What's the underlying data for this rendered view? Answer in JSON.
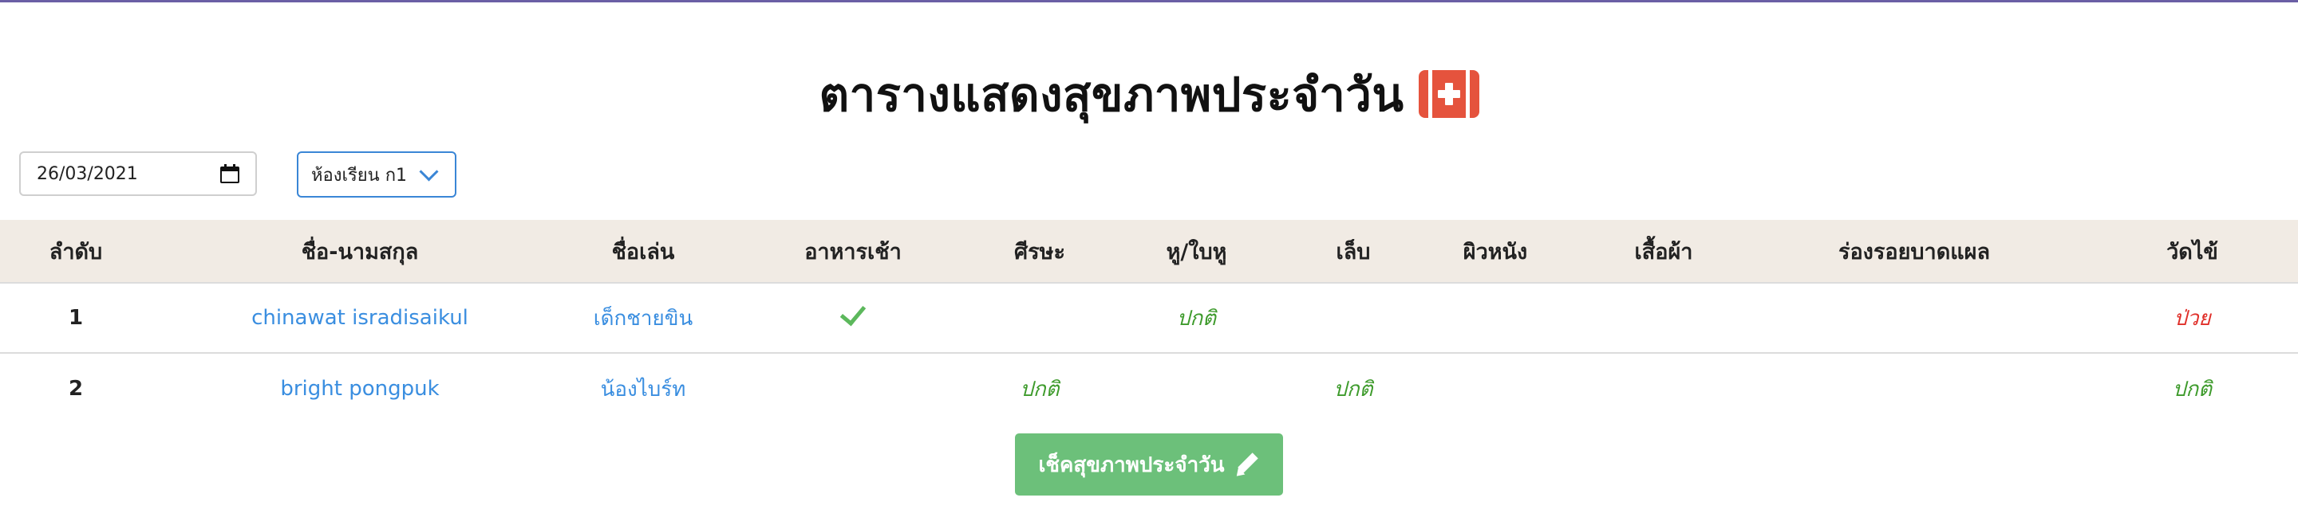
{
  "header": {
    "title": "ตารางแสดงสุขภาพประจำวัน",
    "title_icon": "medical-kit-icon"
  },
  "filters": {
    "date_value": "26/03/2021",
    "room_value": "ห้องเรียน ก1"
  },
  "table": {
    "columns": [
      "ลำดับ",
      "ชื่อ-นามสกุล",
      "ชื่อเล่น",
      "อาหารเช้า",
      "ศีรษะ",
      "หู/ใบหู",
      "เล็บ",
      "ผิวหนัง",
      "เสื้อผ้า",
      "ร่องรอยบาดแผล",
      "วัดไข้"
    ],
    "rows": [
      {
        "no": "1",
        "name": "chinawat isradisaikul",
        "nickname": "เด็กชายขิน",
        "breakfast": "check-icon",
        "head": "",
        "ear": "ปกติ",
        "nail": "",
        "skin": "",
        "clothes": "",
        "wound": "",
        "fever": "ป่วย"
      },
      {
        "no": "2",
        "name": "bright pongpuk",
        "nickname": "น้องไบร์ท",
        "breakfast": "",
        "head": "ปกติ",
        "ear": "",
        "nail": "ปกติ",
        "skin": "",
        "clothes": "",
        "wound": "",
        "fever": "ปกติ"
      }
    ]
  },
  "actions": {
    "check_button_label": "เช็คสุขภาพประจำวัน"
  },
  "colors": {
    "accent_line": "#6b5fa5",
    "header_bg": "#f1ebe4",
    "link": "#3a8ee0",
    "ok": "#3e9b2c",
    "sick": "#e0302a",
    "button": "#6cc07a",
    "medkit": "#e5533d"
  }
}
